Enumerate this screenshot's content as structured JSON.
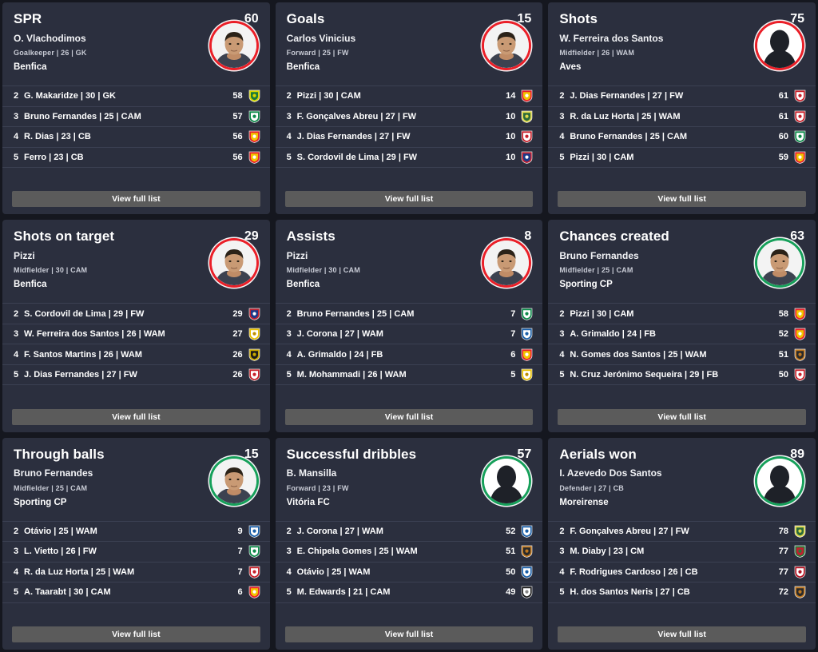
{
  "ui": {
    "full_list_label": "View full list",
    "page_background": "#15171f",
    "card_background": "#2b2f3e",
    "divider_color": "#3b4052",
    "button_color": "#5b5b5b",
    "ring_red": "#ea1f28",
    "ring_green": "#16a05a"
  },
  "cards": [
    {
      "stat": "SPR",
      "value": "60",
      "leader": {
        "name": "O. Vlachodimos",
        "meta": "Goalkeeper | 26 | GK",
        "team": "Benfica",
        "avatar": "player-photo",
        "ring": "red"
      },
      "rows": [
        {
          "rank": "2",
          "label": "G. Makaridze | 30 | GK",
          "value": "58",
          "crest": "crest-pacos"
        },
        {
          "rank": "3",
          "label": "Bruno Fernandes | 25 | CAM",
          "value": "57",
          "crest": "crest-sporting"
        },
        {
          "rank": "4",
          "label": "R. Dias | 23 | CB",
          "value": "56",
          "crest": "crest-benfica"
        },
        {
          "rank": "5",
          "label": "Ferro | 23 | CB",
          "value": "56",
          "crest": "crest-benfica"
        }
      ]
    },
    {
      "stat": "Goals",
      "value": "15",
      "leader": {
        "name": "Carlos Vinicius",
        "meta": "Forward | 25 | FW",
        "team": "Benfica",
        "avatar": "player-photo",
        "ring": "red"
      },
      "rows": [
        {
          "rank": "2",
          "label": "Pizzi | 30 | CAM",
          "value": "14",
          "crest": "crest-benfica"
        },
        {
          "rank": "3",
          "label": "F. Gonçalves Abreu | 27 | FW",
          "value": "10",
          "crest": "crest-tondela"
        },
        {
          "rank": "4",
          "label": "J. Dias Fernandes | 27 | FW",
          "value": "10",
          "crest": "crest-braga"
        },
        {
          "rank": "5",
          "label": "S. Cordovil de Lima | 29 | FW",
          "value": "10",
          "crest": "crest-gilvicente"
        }
      ]
    },
    {
      "stat": "Shots",
      "value": "75",
      "leader": {
        "name": "W. Ferreira dos Santos",
        "meta": "Midfielder | 26 | WAM",
        "team": "Aves",
        "avatar": "silhouette",
        "ring": "red"
      },
      "rows": [
        {
          "rank": "2",
          "label": "J. Dias Fernandes | 27 | FW",
          "value": "61",
          "crest": "crest-braga"
        },
        {
          "rank": "3",
          "label": "R. da Luz Horta | 25 | WAM",
          "value": "61",
          "crest": "crest-braga"
        },
        {
          "rank": "4",
          "label": "Bruno Fernandes | 25 | CAM",
          "value": "60",
          "crest": "crest-sporting"
        },
        {
          "rank": "5",
          "label": "Pizzi | 30 | CAM",
          "value": "59",
          "crest": "crest-benfica"
        }
      ]
    },
    {
      "stat": "Shots on target",
      "value": "29",
      "leader": {
        "name": "Pizzi",
        "meta": "Midfielder | 30 | CAM",
        "team": "Benfica",
        "avatar": "player-photo",
        "ring": "red"
      },
      "rows": [
        {
          "rank": "2",
          "label": "S. Cordovil de Lima | 29 | FW",
          "value": "29",
          "crest": "crest-gilvicente"
        },
        {
          "rank": "3",
          "label": "W. Ferreira dos Santos | 26 | WAM",
          "value": "27",
          "crest": "crest-aves"
        },
        {
          "rank": "4",
          "label": "F. Santos Martins | 26 | WAM",
          "value": "26",
          "crest": "crest-famalicao"
        },
        {
          "rank": "5",
          "label": "J. Dias Fernandes | 27 | FW",
          "value": "26",
          "crest": "crest-braga"
        }
      ]
    },
    {
      "stat": "Assists",
      "value": "8",
      "leader": {
        "name": "Pizzi",
        "meta": "Midfielder | 30 | CAM",
        "team": "Benfica",
        "avatar": "player-photo",
        "ring": "red"
      },
      "rows": [
        {
          "rank": "2",
          "label": "Bruno Fernandes | 25 | CAM",
          "value": "7",
          "crest": "crest-sporting"
        },
        {
          "rank": "3",
          "label": "J. Corona | 27 | WAM",
          "value": "7",
          "crest": "crest-porto"
        },
        {
          "rank": "4",
          "label": "A. Grimaldo | 24 | FB",
          "value": "6",
          "crest": "crest-benfica"
        },
        {
          "rank": "5",
          "label": "M. Mohammadi | 26 | WAM",
          "value": "5",
          "crest": "crest-aves"
        }
      ]
    },
    {
      "stat": "Chances created",
      "value": "63",
      "leader": {
        "name": "Bruno Fernandes",
        "meta": "Midfielder | 25 | CAM",
        "team": "Sporting CP",
        "avatar": "player-photo",
        "ring": "green"
      },
      "rows": [
        {
          "rank": "2",
          "label": "Pizzi | 30 | CAM",
          "value": "58",
          "crest": "crest-benfica"
        },
        {
          "rank": "3",
          "label": "A. Grimaldo | 24 | FB",
          "value": "52",
          "crest": "crest-benfica"
        },
        {
          "rank": "4",
          "label": "N. Gomes dos Santos | 25 | WAM",
          "value": "51",
          "crest": "crest-moreirense"
        },
        {
          "rank": "5",
          "label": "N. Cruz Jerónimo Sequeira | 29 | FB",
          "value": "50",
          "crest": "crest-braga"
        }
      ]
    },
    {
      "stat": "Through balls",
      "value": "15",
      "leader": {
        "name": "Bruno Fernandes",
        "meta": "Midfielder | 25 | CAM",
        "team": "Sporting CP",
        "avatar": "player-photo",
        "ring": "green"
      },
      "rows": [
        {
          "rank": "2",
          "label": "Otávio | 25 | WAM",
          "value": "9",
          "crest": "crest-porto"
        },
        {
          "rank": "3",
          "label": "L. Vietto | 26 | FW",
          "value": "7",
          "crest": "crest-sporting"
        },
        {
          "rank": "4",
          "label": "R. da Luz Horta | 25 | WAM",
          "value": "7",
          "crest": "crest-braga"
        },
        {
          "rank": "5",
          "label": "A. Taarabt | 30 | CAM",
          "value": "6",
          "crest": "crest-benfica"
        }
      ]
    },
    {
      "stat": "Successful dribbles",
      "value": "57",
      "leader": {
        "name": "B. Mansilla",
        "meta": "Forward | 23 | FW",
        "team": "Vitória FC",
        "avatar": "silhouette",
        "ring": "green"
      },
      "rows": [
        {
          "rank": "2",
          "label": "J. Corona | 27 | WAM",
          "value": "52",
          "crest": "crest-porto"
        },
        {
          "rank": "3",
          "label": "E. Chipela Gomes | 25 | WAM",
          "value": "51",
          "crest": "crest-moreirense"
        },
        {
          "rank": "4",
          "label": "Otávio | 25 | WAM",
          "value": "50",
          "crest": "crest-porto"
        },
        {
          "rank": "5",
          "label": "M. Edwards | 21 | CAM",
          "value": "49",
          "crest": "crest-vitoria"
        }
      ]
    },
    {
      "stat": "Aerials won",
      "value": "89",
      "leader": {
        "name": "I. Azevedo Dos Santos",
        "meta": "Defender | 27 | CB",
        "team": "Moreirense",
        "avatar": "silhouette",
        "ring": "green"
      },
      "rows": [
        {
          "rank": "2",
          "label": "F. Gonçalves Abreu | 27 | FW",
          "value": "78",
          "crest": "crest-tondela"
        },
        {
          "rank": "3",
          "label": "M. Diaby | 23 | CM",
          "value": "77",
          "crest": "crest-maritimo"
        },
        {
          "rank": "4",
          "label": "F. Rodrigues Cardoso | 26 | CB",
          "value": "77",
          "crest": "crest-santaclara"
        },
        {
          "rank": "5",
          "label": "H. dos Santos Neris | 27 | CB",
          "value": "72",
          "crest": "crest-moreirense"
        }
      ]
    }
  ]
}
